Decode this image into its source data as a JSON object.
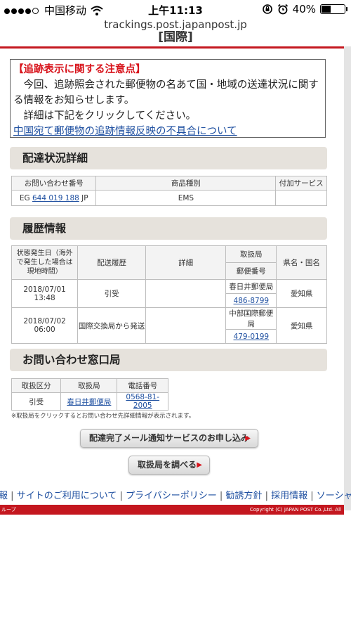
{
  "status_bar": {
    "carrier": "中国移动",
    "time": "上午11:13",
    "battery": "40%",
    "battery_level": 0.4,
    "signal_dots": 5,
    "signal_filled": 4
  },
  "browser": {
    "url": "trackings.post.japanpost.jp"
  },
  "header": {
    "cut_title": "[国際]"
  },
  "notice": {
    "title": "【追跡表示に関する注意点】",
    "line1": "今回、追跡照会された郵便物の名あて国・地域の送達状況に関する情報をお知らせします。",
    "line2": "詳細は下記をクリックしてください。",
    "link": "中国宛て郵便物の追跡情報反映の不具合について"
  },
  "detail": {
    "title": "配達状況詳細",
    "headers": [
      "お問い合わせ番号",
      "商品種別",
      "付加サービス"
    ],
    "tracking_prefix": "EG",
    "tracking_number": "644 019 188",
    "tracking_suffix": "JP",
    "product": "EMS",
    "service": ""
  },
  "history": {
    "title": "履歴情報",
    "headers": {
      "date": "状態発生日（海外で発生した場合は現地時間）",
      "event": "配送履歴",
      "detail": "詳細",
      "office": "取扱局",
      "postcode": "郵便番号",
      "region": "県名・国名"
    },
    "rows": [
      {
        "date": "2018/07/01",
        "time": "13:48",
        "event": "引受",
        "detail": "",
        "office": "春日井郵便局",
        "postcode": "486-8799",
        "region": "愛知県"
      },
      {
        "date": "2018/07/02",
        "time": "06:00",
        "event": "国際交換局から発送",
        "detail": "",
        "office": "中部国際郵便局",
        "postcode": "479-0199",
        "region": "愛知県"
      }
    ]
  },
  "contact": {
    "title": "お問い合わせ窓口局",
    "headers": [
      "取扱区分",
      "取扱局",
      "電話番号"
    ],
    "category": "引受",
    "office": "春日井郵便局",
    "phone": "0568-81-2005",
    "note": "※取扱局をクリックするとお問い合わせ先詳細情報が表示されます。"
  },
  "buttons": {
    "mail_service": "配達完了メール通知サービスのお申し込み",
    "find_office": "取扱局を調べる"
  },
  "footer": {
    "links": [
      "報",
      "サイトのご利用について",
      "プライバシーポリシー",
      "勧誘方針",
      "採用情報",
      "ソーシャル"
    ],
    "group": "ループ",
    "copyright": "Copyright (C) JAPAN POST Co.,Ltd. All"
  }
}
